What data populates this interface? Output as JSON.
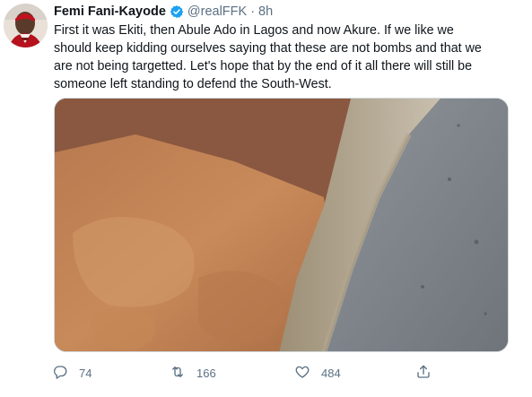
{
  "tweet": {
    "author_name": "Femi Fani-Kayode",
    "handle": "@realFFK",
    "separator": "·",
    "time": "8h",
    "text_lines": [
      "First it was Ekiti, then Abule Ado in Lagos and now  Akure. If we like we",
      "should keep kidding ourselves saying that these are not bombs and that we",
      "are not being targetted. Let's hope that by the end of it all there will still be",
      "someone left standing to defend the South-West."
    ],
    "stats": {
      "replies": "74",
      "retweets": "166",
      "likes": "484"
    }
  },
  "icons": {
    "verified": "verified-badge-icon",
    "reply": "reply-icon",
    "retweet": "retweet-icon",
    "like": "heart-icon",
    "share": "share-icon"
  },
  "colors": {
    "verified_blue": "#1da1f2",
    "muted_text": "#5b7083"
  }
}
